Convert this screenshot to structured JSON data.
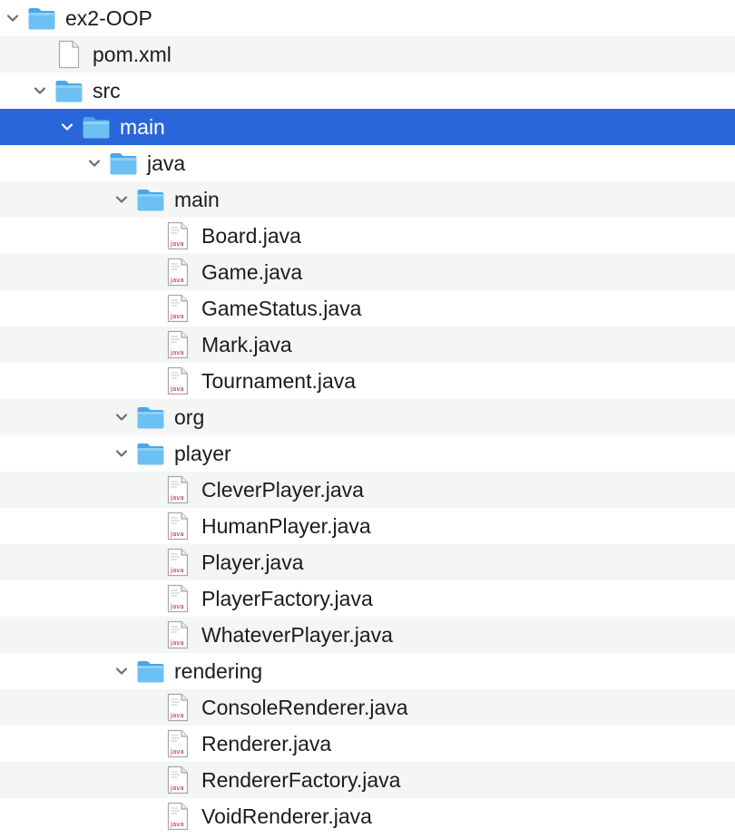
{
  "colors": {
    "selection": "#2866d9",
    "folder": "#5bb4ee",
    "row_alt": "#f4f5f5"
  },
  "tree": {
    "root_folder": {
      "label": "ex2-OOP",
      "icon": "folder-icon"
    },
    "pom_file": {
      "label": "pom.xml",
      "icon": "xml-file-icon"
    },
    "src_folder": {
      "label": "src",
      "icon": "folder-icon"
    },
    "main_folder": {
      "label": "main",
      "icon": "folder-icon",
      "selected": true
    },
    "java_folder": {
      "label": "java",
      "icon": "folder-icon"
    },
    "pkg_main": {
      "label": "main",
      "icon": "folder-icon",
      "files": [
        "Board.java",
        "Game.java",
        "GameStatus.java",
        "Mark.java",
        "Tournament.java"
      ]
    },
    "pkg_org": {
      "label": "org",
      "icon": "folder-icon"
    },
    "pkg_player": {
      "label": "player",
      "icon": "folder-icon",
      "files": [
        "CleverPlayer.java",
        "HumanPlayer.java",
        "Player.java",
        "PlayerFactory.java",
        "WhateverPlayer.java"
      ]
    },
    "pkg_rendering": {
      "label": "rendering",
      "icon": "folder-icon",
      "files": [
        "ConsoleRenderer.java",
        "Renderer.java",
        "RendererFactory.java",
        "VoidRenderer.java"
      ]
    },
    "java_icon_text": "java"
  }
}
